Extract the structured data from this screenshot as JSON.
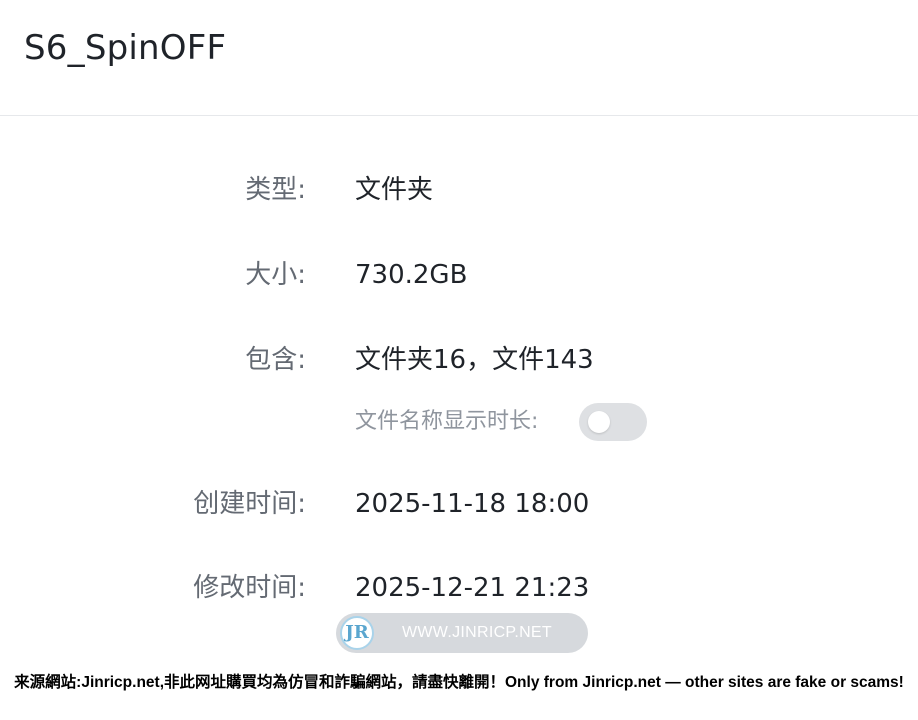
{
  "header": {
    "title": "S6_SpinOFF"
  },
  "details": [
    {
      "label": "类型:",
      "value": "文件夹"
    },
    {
      "label": "大小:",
      "value": "730.2GB"
    },
    {
      "label": "包含:",
      "value": "文件夹16，文件143"
    },
    {
      "label": "创建时间:",
      "value": "2025-11-18 18:00"
    },
    {
      "label": "修改时间:",
      "value": "2025-12-21 21:23"
    }
  ],
  "display_duration": {
    "label": "文件名称显示时长:",
    "enabled": false
  },
  "watermark": {
    "text": "WWW.JINRICP.NET"
  },
  "footer": {
    "notice": "来源網站:Jinricp.net,非此网址購買均為仿冒和詐騙網站，請盡快離開！Only from Jinricp.net — other sites are fake or scams!"
  },
  "colors": {
    "label": "#646a73",
    "value": "#1f2329",
    "toggle_off": "#dee0e3",
    "divider": "#e6e8eb"
  }
}
